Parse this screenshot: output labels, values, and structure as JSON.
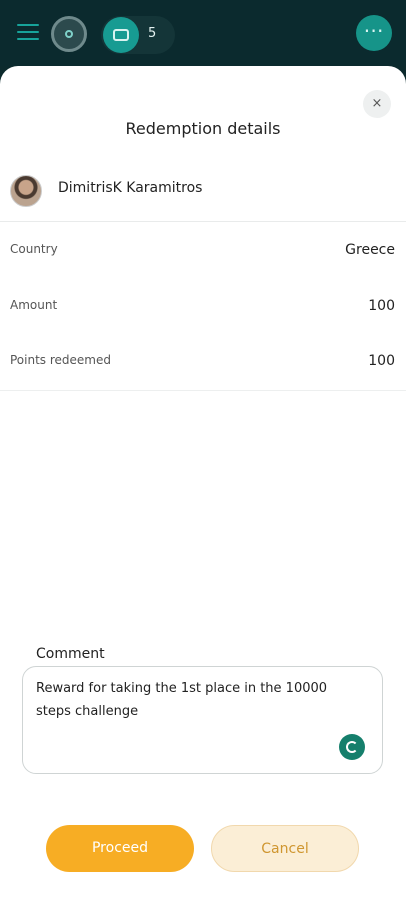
{
  "header": {
    "menu_icon": "hamburger-icon",
    "wallet_count": "5",
    "more_icon": "ellipsis-icon",
    "more_label": "⋯"
  },
  "sheet": {
    "close_label": "×",
    "title": "Redemption details"
  },
  "user": {
    "name": "DimitrisK Karamitros"
  },
  "details": [
    {
      "label": "Country",
      "value": "Greece"
    },
    {
      "label": "Amount",
      "value": "100"
    },
    {
      "label": "Points redeemed",
      "value": "100"
    }
  ],
  "comment": {
    "label": "Comment",
    "value": "Reward for taking the 1st place in the 10000 steps challenge"
  },
  "actions": {
    "proceed": "Proceed",
    "cancel": "Cancel"
  },
  "colors": {
    "topbar": "#0b2a2e",
    "accent_teal": "#169489",
    "proceed": "#f7ad24",
    "cancel_bg": "#fbeed6"
  }
}
